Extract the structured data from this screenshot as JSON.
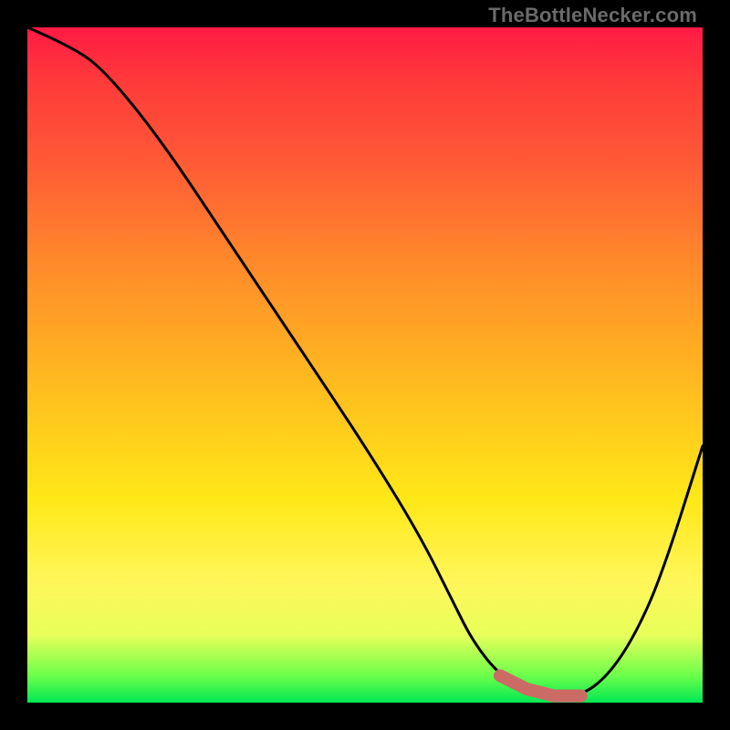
{
  "watermark": {
    "text": "TheBottleNecker.com"
  },
  "chart_data": {
    "type": "line",
    "title": "",
    "xlabel": "",
    "ylabel": "",
    "xlim": [
      0,
      100
    ],
    "ylim": [
      0,
      100
    ],
    "grid": false,
    "series": [
      {
        "name": "curve",
        "x": [
          0,
          7,
          12,
          20,
          30,
          40,
          50,
          58,
          63,
          66,
          70,
          74,
          78,
          82,
          86,
          90,
          94,
          100
        ],
        "values": [
          100,
          97,
          93,
          83,
          68,
          53,
          38,
          25,
          15,
          9,
          4,
          2,
          1,
          1,
          4,
          10,
          19,
          38
        ]
      }
    ],
    "highlight": {
      "x_start": 68,
      "x_end": 82,
      "color": "#cc6a66"
    },
    "background_gradient": [
      "#ff1a44",
      "#ff8a2a",
      "#ffe818",
      "#00e854"
    ]
  }
}
